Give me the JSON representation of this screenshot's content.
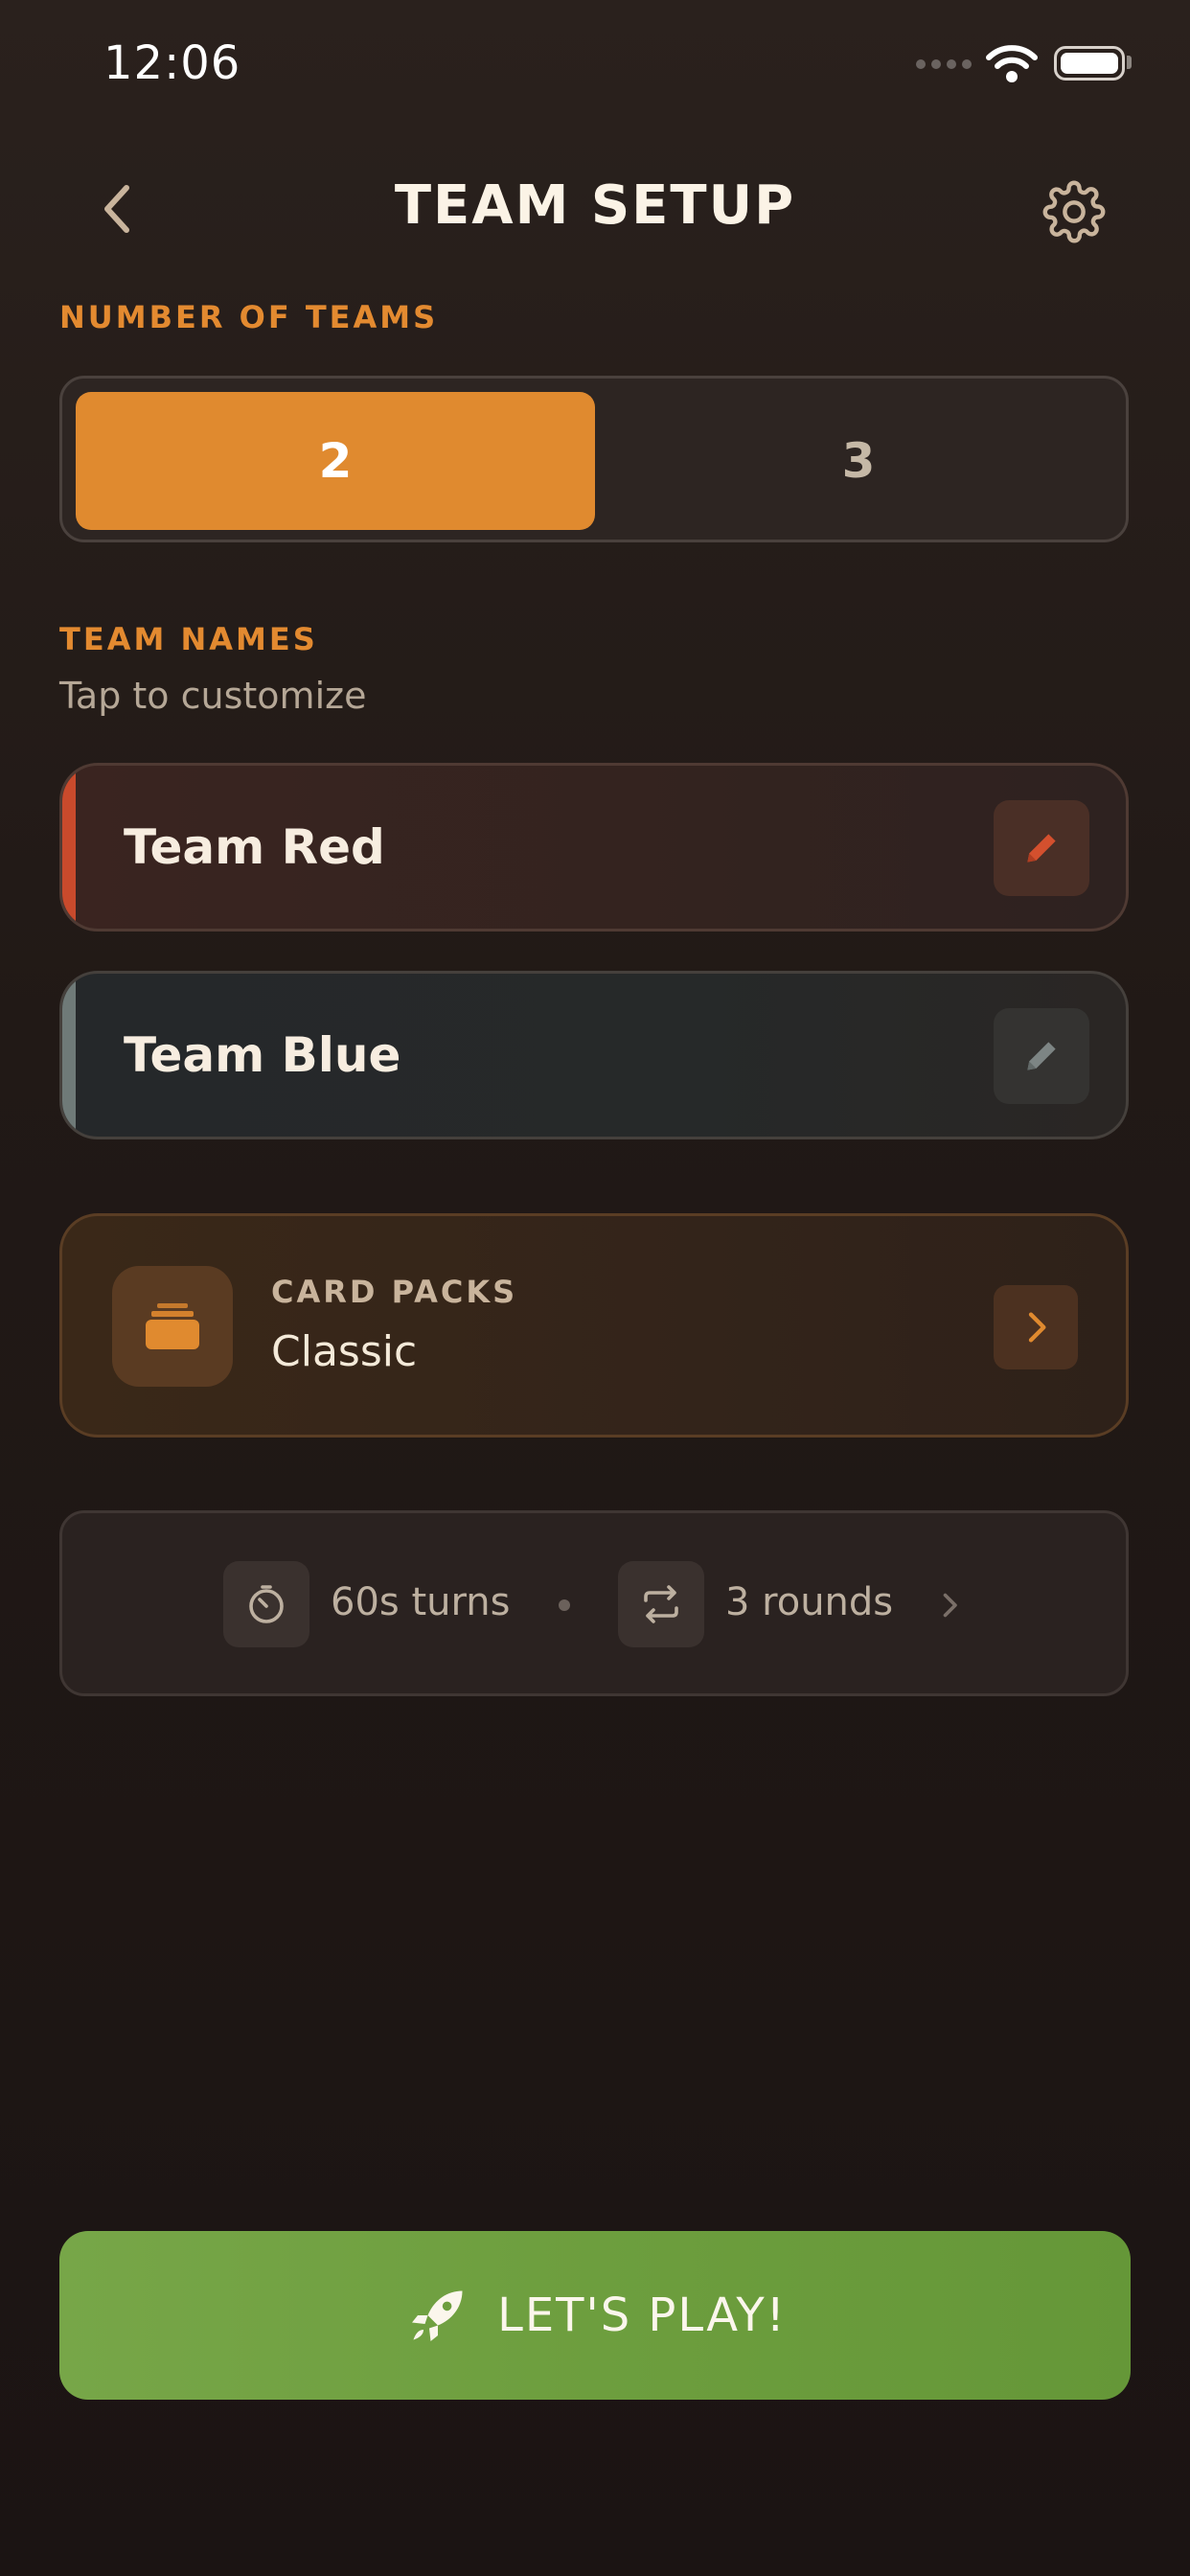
{
  "status_bar": {
    "time": "12:06"
  },
  "header": {
    "title": "TEAM SETUP"
  },
  "number_of_teams": {
    "label": "NUMBER OF TEAMS",
    "options": [
      "2",
      "3"
    ],
    "selected": "2"
  },
  "team_names": {
    "label": "TEAM NAMES",
    "hint": "Tap to customize",
    "teams": [
      {
        "name": "Team Red",
        "color": "#c94a2c"
      },
      {
        "name": "Team Blue",
        "color": "#6f7a78"
      }
    ]
  },
  "card_packs": {
    "label": "CARD PACKS",
    "value": "Classic"
  },
  "game_settings": {
    "turn_time": "60s turns",
    "rounds": "3 rounds"
  },
  "play_button": {
    "label": "LET'S PLAY!"
  },
  "colors": {
    "accent": "#e08a2f",
    "play": "#6d9e3e",
    "background": "#211916"
  }
}
